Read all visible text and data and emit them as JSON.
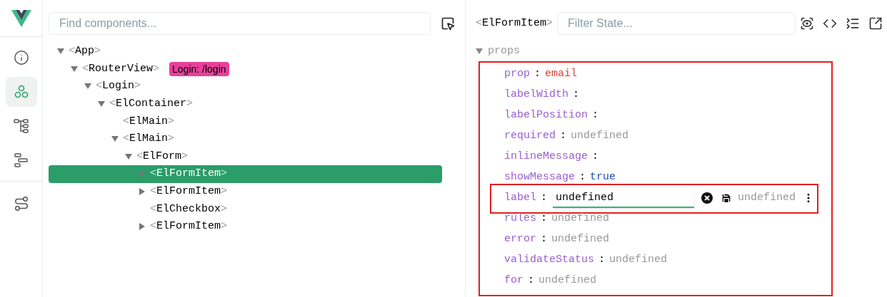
{
  "sidebar": {
    "items": [
      {
        "kind": "info",
        "selected": false
      },
      {
        "kind": "components",
        "selected": true
      },
      {
        "kind": "tree",
        "selected": false
      },
      {
        "kind": "timeline",
        "selected": false
      },
      {
        "kind": "routes",
        "selected": false
      }
    ]
  },
  "component_tree": {
    "search": {
      "placeholder": "Find components..."
    },
    "nodes": [
      {
        "name": "<App>",
        "kind": "branch",
        "expanded": true,
        "selected": false,
        "children": [
          {
            "name": "<RouterView>",
            "kind": "branch",
            "expanded": true,
            "selected": false,
            "badge": "Login: /login",
            "color": "#e8409a",
            "children": [
              {
                "name": "<Login>",
                "kind": "branch",
                "expanded": true,
                "selected": false,
                "children": [
                  {
                    "name": "<ElContainer>",
                    "kind": "branch",
                    "expanded": true,
                    "selected": false,
                    "children": [
                      {
                        "name": "<ElMain>",
                        "kind": "leaf",
                        "selected": false
                      },
                      {
                        "name": "<ElMain>",
                        "kind": "branch",
                        "expanded": true,
                        "selected": false,
                        "children": [
                          {
                            "name": "<ElForm>",
                            "kind": "branch",
                            "expanded": true,
                            "selected": false,
                            "children": [
                              {
                                "name": "<ElFormItem>",
                                "kind": "branch",
                                "expanded": false,
                                "selected": true
                              },
                              {
                                "name": "<ElFormItem>",
                                "kind": "branch",
                                "expanded": false,
                                "selected": false
                              },
                              {
                                "name": "<ElCheckbox>",
                                "kind": "leaf",
                                "selected": false
                              },
                              {
                                "name": "<ElFormItem>",
                                "kind": "branch",
                                "expanded": false,
                                "selected": false
                              }
                            ]
                          }
                        ]
                      }
                    ]
                  }
                ]
              }
            ]
          }
        ]
      }
    ]
  },
  "inspector": {
    "component": "<ElFormItem>",
    "filter": {
      "placeholder": "Filter State..."
    },
    "section": {
      "title": "props",
      "expanded": true,
      "highlighted": true,
      "props": [
        {
          "key": "prop",
          "separator": ":",
          "kind": "string",
          "value": "email",
          "highlighted": false
        },
        {
          "key": "labelWidth",
          "separator": ":",
          "kind": "empty",
          "highlighted": false
        },
        {
          "key": "labelPosition",
          "separator": ":",
          "kind": "empty",
          "highlighted": false
        },
        {
          "key": "required",
          "separator": ":",
          "kind": "undefined",
          "value": "undefined",
          "highlighted": false
        },
        {
          "key": "inlineMessage",
          "separator": ":",
          "kind": "empty",
          "highlighted": false
        },
        {
          "key": "showMessage",
          "separator": ":",
          "kind": "boolean",
          "value": "true",
          "highlighted": false
        },
        {
          "key": "label",
          "separator": ":",
          "kind": "editing",
          "value": "undefined",
          "preview": "undefined",
          "highlighted": true
        },
        {
          "key": "rules",
          "separator": ":",
          "kind": "undefined",
          "value": "undefined",
          "highlighted": false
        },
        {
          "key": "error",
          "separator": ":",
          "kind": "undefined",
          "value": "undefined",
          "highlighted": false
        },
        {
          "key": "validateStatus",
          "separator": ":",
          "kind": "undefined",
          "value": "undefined",
          "highlighted": false
        },
        {
          "key": "for",
          "separator": ":",
          "kind": "undefined",
          "value": "undefined",
          "highlighted": false
        }
      ]
    }
  }
}
